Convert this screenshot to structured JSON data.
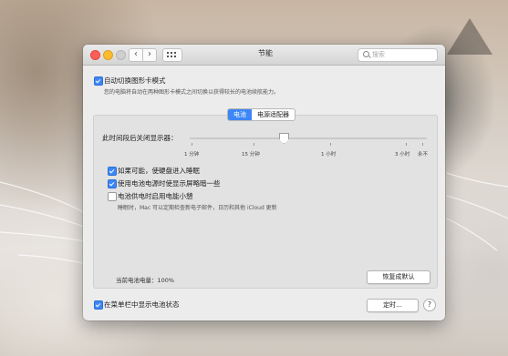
{
  "window": {
    "title": "节能"
  },
  "toolbar": {
    "search_placeholder": "搜索"
  },
  "auto_switch": {
    "label": "自动切换图形卡模式",
    "description": "您的电脑将自动在两种图形卡模式之间切换以获得较长的电池续航能力。",
    "checked": true
  },
  "tabs": [
    {
      "label": "电池",
      "active": true
    },
    {
      "label": "电源适配器",
      "active": false
    }
  ],
  "display_sleep": {
    "label": "此时间段后关闭显示器：",
    "ticks": [
      "1 分钟",
      "15 分钟",
      "1 小时",
      "3 小时",
      "永不"
    ],
    "value": "15 分钟"
  },
  "options": [
    {
      "label": "如果可能，使硬盘进入睡眠",
      "checked": true
    },
    {
      "label": "使用电池电源时使显示屏略暗一些",
      "checked": true
    },
    {
      "label": "电池供电时启用电能小憩",
      "checked": false,
      "description": "睡眠时，Mac 可以定期检查新电子邮件，日历和其他 iCloud 更新"
    }
  ],
  "battery": {
    "label": "当前电池电量：",
    "value": "100%"
  },
  "restore_button": "恢复成默认",
  "menubar_status": {
    "label": "在菜单栏中显示电池状态",
    "checked": true
  },
  "schedule_button": "定时...",
  "help_label": "?"
}
